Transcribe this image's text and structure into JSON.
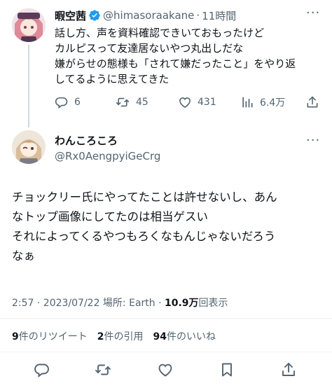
{
  "parent_tweet": {
    "display_name": "暇空茜",
    "handle": "@himasoraakane",
    "separator": "·",
    "time": "11時間",
    "text_lines": [
      "話し方、声を資料確認できいておもったけど",
      "カルピスって友達居ないやつ丸出しだな",
      "嫌がらせの態様も「されて嫌だったこと」をやり返",
      "してるように思えてきた"
    ],
    "metrics": {
      "replies": "6",
      "retweets": "45",
      "likes": "431",
      "views": "6.4万"
    }
  },
  "main_tweet": {
    "display_name": "わんころころ",
    "handle": "@Rx0AengpyiGeCrg",
    "text_lines": [
      "チョックリー氏にやってたことは許せないし、あん",
      "なトップ画像にしてたのは相当ゲスい",
      "それによってくるやつもろくなもんじゃないだろう",
      "なぁ"
    ],
    "timestamp": "2:57 · 2023/07/22 場所: Earth · ",
    "view_count": "10.9万",
    "view_label": "回表示"
  },
  "stats": {
    "retweets_count": "9",
    "retweets_label": "件のリツイート",
    "quotes_count": "2",
    "quotes_label": "件の引用",
    "likes_count": "94",
    "likes_label": "件のいいね"
  },
  "colors": {
    "accent": "#1d9bf0",
    "muted": "#536471",
    "divider": "#eff3f4"
  }
}
